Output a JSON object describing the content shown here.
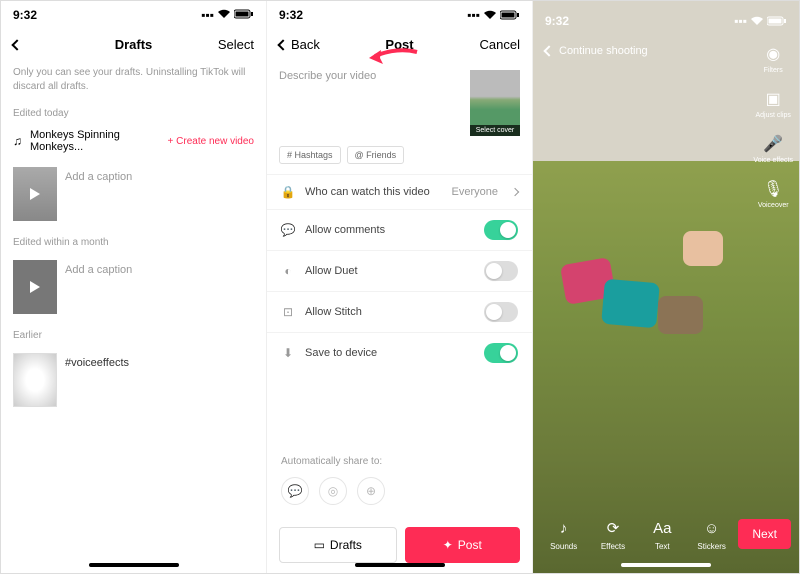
{
  "status": {
    "time": "9:32"
  },
  "panel1": {
    "title": "Drafts",
    "select": "Select",
    "hint": "Only you can see your drafts. Uninstalling TikTok will discard all drafts.",
    "sections": {
      "today": "Edited today",
      "month": "Edited within a month",
      "earlier": "Earlier"
    },
    "music_title": "Monkeys Spinning Monkeys...",
    "create_link": "+ Create new video",
    "caption_ph": "Add a caption",
    "voice_caption": "#voiceeffects"
  },
  "panel2": {
    "back": "Back",
    "title": "Post",
    "cancel": "Cancel",
    "desc_ph": "Describe your video",
    "cover": "Select cover",
    "hashtags": "# Hashtags",
    "friends": "@ Friends",
    "privacy_label": "Who can watch this video",
    "privacy_value": "Everyone",
    "comments": "Allow comments",
    "duet": "Allow Duet",
    "stitch": "Allow Stitch",
    "save": "Save to device",
    "share_label": "Automatically share to:",
    "drafts_btn": "Drafts",
    "post_btn": "Post"
  },
  "panel3": {
    "continue": "Continue shooting",
    "side": {
      "filters": "Filters",
      "adjust": "Adjust clips",
      "voice": "Voice effects",
      "voiceover": "Voiceover"
    },
    "bottom": {
      "sounds": "Sounds",
      "effects": "Effects",
      "text": "Text",
      "stickers": "Stickers"
    },
    "next": "Next"
  }
}
